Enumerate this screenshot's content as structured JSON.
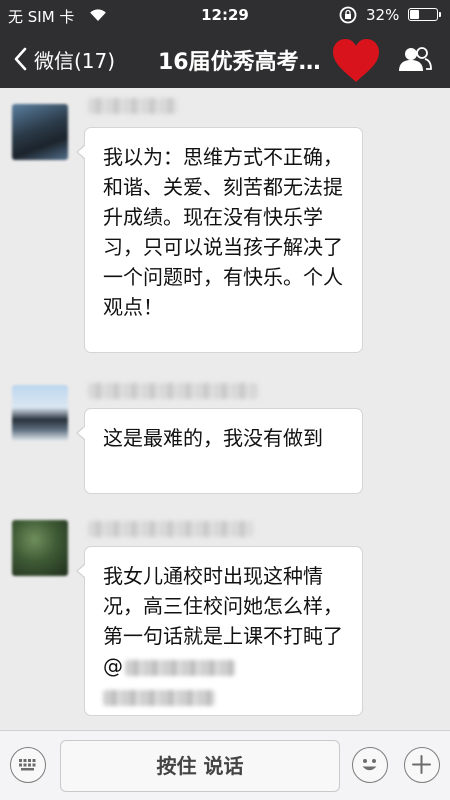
{
  "status_bar": {
    "carrier": "无 SIM 卡",
    "wifi_icon": "wifi-icon",
    "time": "12:29",
    "orientation_lock_icon": "orientation-lock-icon",
    "battery_percent_text": "32%",
    "battery_level": 0.32
  },
  "nav": {
    "back_label": "微信(17)",
    "title": "16届优秀高考…",
    "icons": [
      "chevron-left-icon",
      "heart-sticker",
      "group-members-icon"
    ]
  },
  "messages": [
    {
      "text": "我以为：思维方式不正确，和谐、关爱、刻苦都无法提升成绩。现在没有快乐学习，只可以说当孩子解决了一个问题时，有快乐。个人观点！"
    },
    {
      "text": "这是最难的，我没有做到"
    },
    {
      "text": "我女儿通校时出现这种情况，高三住校问她怎么样，第一句话就是上课不打盹了@"
    }
  ],
  "input_bar": {
    "hold_to_talk_label": "按住 说话",
    "icons": [
      "keyboard-icon",
      "emoji-icon",
      "plus-icon"
    ]
  },
  "colors": {
    "top_bar": "#2f2f31",
    "chat_background": "#ebebeb",
    "bubble": "#ffffff",
    "heart": "#d8131b"
  }
}
